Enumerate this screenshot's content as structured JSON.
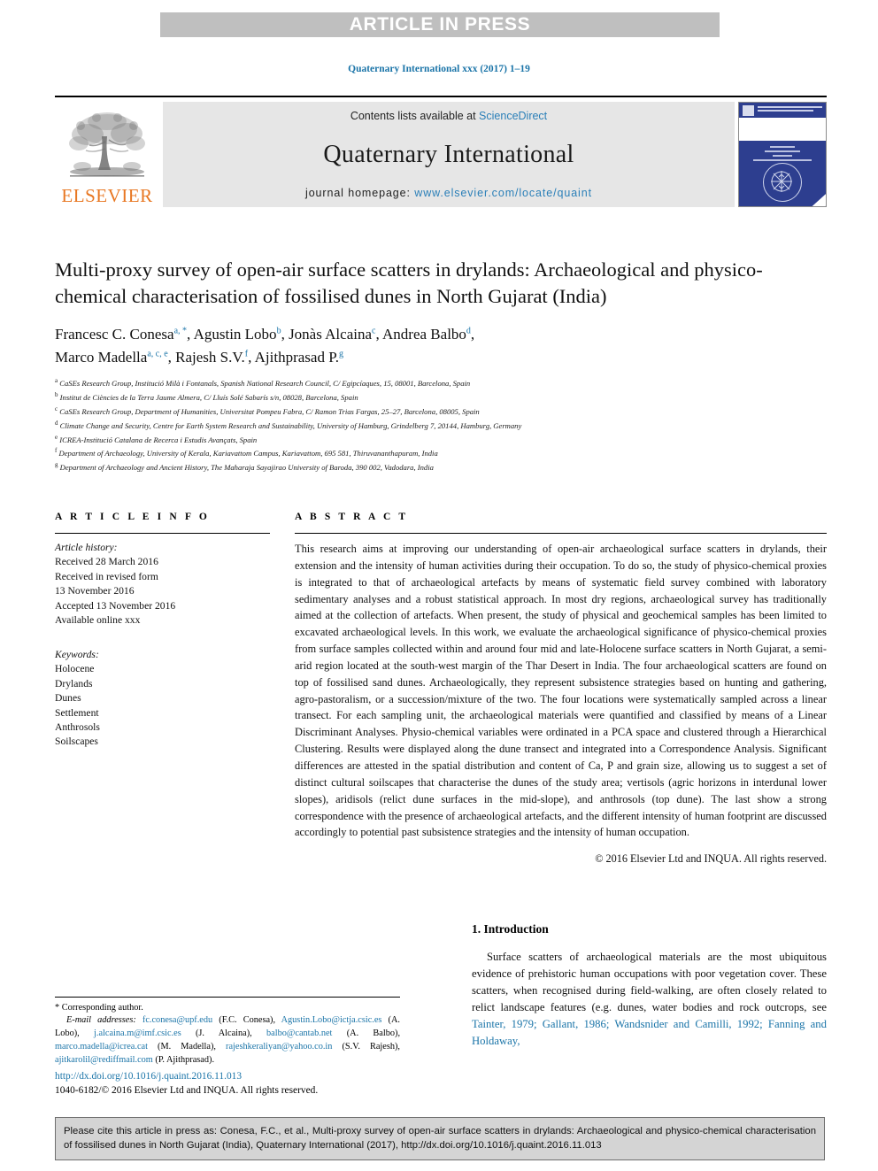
{
  "banner": {
    "text": "ARTICLE IN PRESS"
  },
  "journal_ref": "Quaternary International xxx (2017) 1–19",
  "masthead": {
    "contents_prefix": "Contents lists available at ",
    "contents_link": "ScienceDirect",
    "journal_name": "Quaternary International",
    "homepage_prefix": "journal homepage: ",
    "homepage_url": "www.elsevier.com/locate/quaint",
    "publisher_wordmark": "ELSEVIER"
  },
  "article": {
    "title": "Multi-proxy survey of open-air surface scatters in drylands: Archaeological and physico-chemical characterisation of fossilised dunes in North Gujarat (India)",
    "authors_line1": "Francesc C. Conesa",
    "authors": [
      {
        "name": "Francesc C. Conesa",
        "marks": "a, *"
      },
      {
        "name": "Agustin Lobo",
        "marks": "b"
      },
      {
        "name": "Jonàs Alcaina",
        "marks": "c"
      },
      {
        "name": "Andrea Balbo",
        "marks": "d"
      },
      {
        "name": "Marco Madella",
        "marks": "a, c, e"
      },
      {
        "name": "Rajesh S.V.",
        "marks": "f"
      },
      {
        "name": "Ajithprasad P.",
        "marks": "g"
      }
    ],
    "affiliations": [
      {
        "mark": "a",
        "text": "CaSEs Research Group, Institució Milà i Fontanals, Spanish National Research Council, C/ Egipcíaques, 15, 08001, Barcelona, Spain"
      },
      {
        "mark": "b",
        "text": "Institut de Ciències de la Terra Jaume Almera, C/ Lluís Solé Sabarís s/n, 08028, Barcelona, Spain"
      },
      {
        "mark": "c",
        "text": "CaSEs Research Group, Department of Humanities, Universitat Pompeu Fabra, C/ Ramon Trias Fargas, 25–27, Barcelona, 08005, Spain"
      },
      {
        "mark": "d",
        "text": "Climate Change and Security, Centre for Earth System Research and Sustainability, University of Hamburg, Grindelberg 7, 20144, Hamburg, Germany"
      },
      {
        "mark": "e",
        "text": "ICREA-Institució Catalana de Recerca i Estudis Avançats, Spain"
      },
      {
        "mark": "f",
        "text": "Department of Archaeology, University of Kerala, Kariavattom Campus, Kariavattom, 695 581, Thiruvananthapuram, India"
      },
      {
        "mark": "g",
        "text": "Department of Archaeology and Ancient History, The Maharaja Sayajirao University of Baroda, 390 002, Vadodara, India"
      }
    ]
  },
  "article_info": {
    "heading": "A R T I C L E  I N F O",
    "history_label": "Article history:",
    "history": [
      "Received 28 March 2016",
      "Received in revised form",
      "13 November 2016",
      "Accepted 13 November 2016",
      "Available online xxx"
    ],
    "keywords_label": "Keywords:",
    "keywords": [
      "Holocene",
      "Drylands",
      "Dunes",
      "Settlement",
      "Anthrosols",
      "Soilscapes"
    ]
  },
  "abstract": {
    "heading": "A B S T R A C T",
    "text": "This research aims at improving our understanding of open-air archaeological surface scatters in drylands, their extension and the intensity of human activities during their occupation. To do so, the study of physico-chemical proxies is integrated to that of archaeological artefacts by means of systematic field survey combined with laboratory sedimentary analyses and a robust statistical approach. In most dry regions, archaeological survey has traditionally aimed at the collection of artefacts. When present, the study of physical and geochemical samples has been limited to excavated archaeological levels. In this work, we evaluate the archaeological significance of physico-chemical proxies from surface samples collected within and around four mid and late-Holocene surface scatters in North Gujarat, a semi-arid region located at the south-west margin of the Thar Desert in India. The four archaeological scatters are found on top of fossilised sand dunes. Archaeologically, they represent subsistence strategies based on hunting and gathering, agro-pastoralism, or a succession/mixture of the two. The four locations were systematically sampled across a linear transect. For each sampling unit, the archaeological materials were quantified and classified by means of a Linear Discriminant Analyses. Physio-chemical variables were ordinated in a PCA space and clustered through a Hierarchical Clustering. Results were displayed along the dune transect and integrated into a Correspondence Analysis. Significant differences are attested in the spatial distribution and content of Ca, P and grain size, allowing us to suggest a set of distinct cultural soilscapes that characterise the dunes of the study area; vertisols (agric horizons in interdunal lower slopes), aridisols (relict dune surfaces in the mid-slope), and anthrosols (top dune). The last show a strong correspondence with the presence of archaeological artefacts, and the different intensity of human footprint are discussed accordingly to potential past subsistence strategies and the intensity of human occupation.",
    "copyright": "© 2016 Elsevier Ltd and INQUA. All rights reserved."
  },
  "introduction": {
    "heading": "1.  Introduction",
    "paragraph_pre": "Surface scatters of archaeological materials are the most ubiquitous evidence of prehistoric human occupations with poor vegetation cover. These scatters, when recognised during field-walking, are often closely related to relict landscape features (e.g. dunes, water bodies and rock outcrops, see ",
    "paragraph_citations": "Tainter, 1979; Gallant, 1986; Wandsnider and Camilli, 1992; Fanning and Holdaway,"
  },
  "footnote": {
    "corresponding": "* Corresponding author.",
    "email_label": "E-mail addresses:",
    "emails": [
      {
        "mail": "fc.conesa@upf.edu",
        "who": "(F.C. Conesa)"
      },
      {
        "mail": "Agustin.Lobo@ictja.csic.es",
        "who": "(A. Lobo)"
      },
      {
        "mail": "j.alcaina.m@imf.csic.es",
        "who": "(J. Alcaina)"
      },
      {
        "mail": "balbo@cantab.net",
        "who": "(A. Balbo)"
      },
      {
        "mail": "marco.madella@icrea.cat",
        "who": "(M. Madella)"
      },
      {
        "mail": "rajeshkeraliyan@yahoo.co.in",
        "who": "(S.V. Rajesh)"
      },
      {
        "mail": "ajitkarolil@rediffmail.com",
        "who": "(P. Ajithprasad)"
      }
    ],
    "doi": "http://dx.doi.org/10.1016/j.quaint.2016.11.013",
    "issn_copyright": "1040-6182/© 2016 Elsevier Ltd and INQUA. All rights reserved."
  },
  "cite_box": {
    "text": "Please cite this article in press as: Conesa, F.C., et al., Multi-proxy survey of open-air surface scatters in drylands: Archaeological and physico-chemical characterisation of fossilised dunes in North Gujarat (India), Quaternary International (2017), http://dx.doi.org/10.1016/j.quaint.2016.11.013"
  },
  "colors": {
    "link_blue": "#1a74a8",
    "elsevier_orange": "#e87722",
    "banner_gray": "#bfbfbf",
    "masthead_gray": "#e6e6e6",
    "cite_box_gray": "#d4d4d4",
    "cover_blue": "#2d3e8f"
  }
}
